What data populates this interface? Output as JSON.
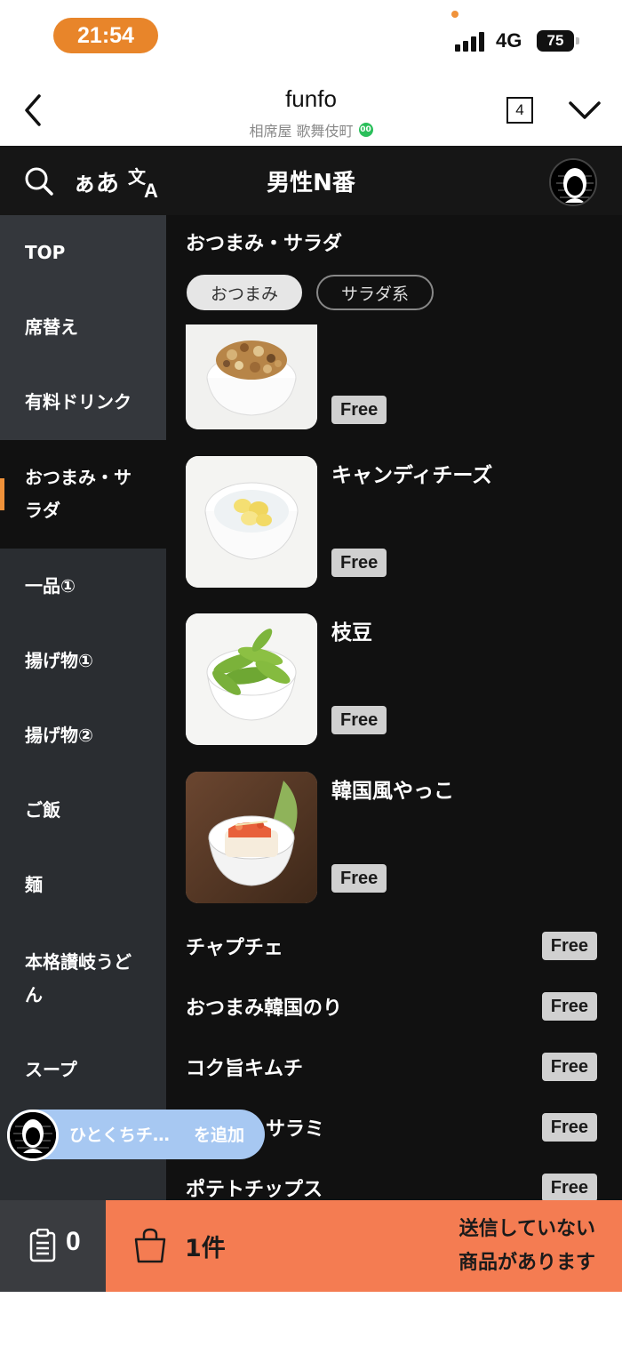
{
  "status_bar": {
    "time": "21:54",
    "network": "4G",
    "battery": "75"
  },
  "browser": {
    "site_title": "funfo",
    "site_subtitle": "相席屋 歌舞伎町",
    "verified_mark": "00",
    "tab_count": "4"
  },
  "toolbar": {
    "hiragana_label": "ぁあ",
    "shop_title": "男性N番"
  },
  "sidebar": {
    "items": [
      {
        "label": "TOP"
      },
      {
        "label": "席替え"
      },
      {
        "label": "有料ドリンク"
      },
      {
        "label": "おつまみ・サラダ"
      },
      {
        "label": "一品①"
      },
      {
        "label": "揚げ物①"
      },
      {
        "label": "揚げ物②"
      },
      {
        "label": "ご飯"
      },
      {
        "label": "麺"
      },
      {
        "label": "本格讃岐うどん"
      },
      {
        "label": "スープ"
      }
    ]
  },
  "main": {
    "category_title": "おつまみ・サラダ",
    "chips": [
      {
        "label": "おつまみ",
        "selected": true
      },
      {
        "label": "サラダ系",
        "selected": false
      }
    ],
    "cards": [
      {
        "name": "",
        "price": "Free",
        "image": "nuts-bowl"
      },
      {
        "name": "キャンディチーズ",
        "price": "Free",
        "image": "candy-cheese-bowl"
      },
      {
        "name": "枝豆",
        "price": "Free",
        "image": "edamame-bowl"
      },
      {
        "name": "韓国風やっこ",
        "price": "Free",
        "image": "korean-tofu-bowl"
      }
    ],
    "list": [
      {
        "name": "チャプチェ",
        "price": "Free"
      },
      {
        "name": "おつまみ韓国のり",
        "price": "Free"
      },
      {
        "name": "コク旨キムチ",
        "price": "Free"
      },
      {
        "name": "サラミ",
        "price": "Free"
      },
      {
        "name": "ポテトチップス",
        "price": "Free"
      }
    ]
  },
  "floating_chip": {
    "text": "ひとくちチ…",
    "action": "を追加"
  },
  "bottom_bar": {
    "order_count": "0",
    "cart_count": "1件",
    "unsent_line1": "送信していない",
    "unsent_line2": "商品があります"
  },
  "colors": {
    "accent": "#f47c52",
    "time_pill": "#e8852a",
    "sidebar_bg": "#2a2d31",
    "main_bg": "#111111",
    "free_badge": "#d0d0d0",
    "floating_chip": "#a7c8f2"
  }
}
